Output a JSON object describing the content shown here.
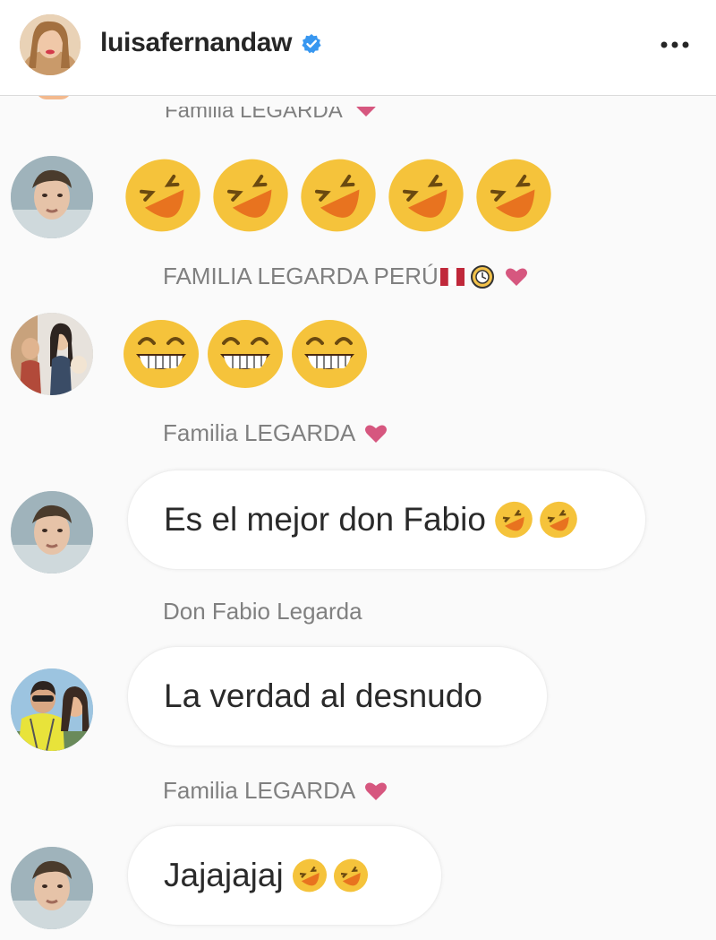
{
  "header": {
    "username": "luisafernandaw",
    "verified": true,
    "accent_color": "#3897f0",
    "more_icon": "more-horizontal-icon"
  },
  "comments": [
    {
      "sender": "Familia LEGARDA",
      "content_type": "emoji",
      "emoji": "rolling-laughing-emoji",
      "emoji_count": 5
    },
    {
      "sender": "FAMILIA LEGARDA PERÚ",
      "content_type": "emoji",
      "emoji": "grinning-squint-emoji",
      "emoji_count": 3
    },
    {
      "sender": "Familia LEGARDA",
      "content_type": "text",
      "text": "Es el mejor don Fabio",
      "emoji": "rolling-laughing-emoji",
      "emoji_count": 2
    },
    {
      "sender": "Don Fabio Legarda",
      "content_type": "text",
      "text": "La verdad al desnudo",
      "emoji_count": 0
    },
    {
      "sender": "Familia LEGARDA",
      "content_type": "text",
      "text": "Jajajajaj",
      "emoji": "rolling-laughing-emoji",
      "emoji_count": 2
    }
  ],
  "colors": {
    "heart": "#d6577f",
    "emoji_face": "#f5c33b",
    "emoji_mouth": "#e8731f",
    "sender_text": "#808080"
  }
}
